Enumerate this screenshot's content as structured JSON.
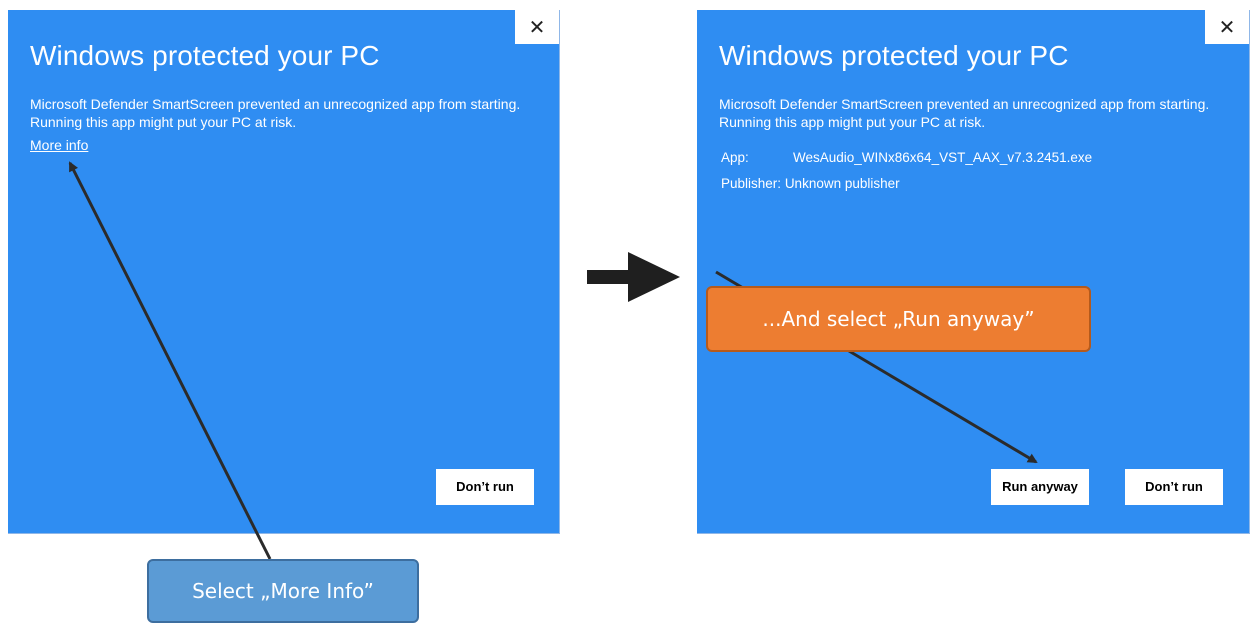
{
  "left_dialog": {
    "title": "Windows protected your PC",
    "description": "Microsoft Defender SmartScreen prevented an unrecognized app from starting. Running this app might put your PC at risk.",
    "more_info_link": "More info",
    "close_glyph": "✕",
    "dont_run_label": "Don’t run"
  },
  "right_dialog": {
    "title": "Windows protected your PC",
    "description": "Microsoft Defender SmartScreen prevented an unrecognized app from starting. Running this app might put your PC at risk.",
    "app_label": "App:",
    "app_value": "WesAudio_WINx86x64_VST_AAX_v7.3.2451.exe",
    "publisher_label": "Publisher:",
    "publisher_value": "Unknown publisher",
    "close_glyph": "✕",
    "run_anyway_label": "Run anyway",
    "dont_run_label": "Don’t run"
  },
  "callouts": {
    "more_info": "Select „More Info”",
    "run_anyway": "...And select „Run anyway”"
  },
  "colors": {
    "dialog_bg": "#2f8df2",
    "callout_blue": "#5b9bd5",
    "callout_orange": "#ed7d31",
    "arrow": "#2b2b2b"
  },
  "icons": {
    "close": "close-icon",
    "step_arrow": "right-arrow-icon"
  }
}
